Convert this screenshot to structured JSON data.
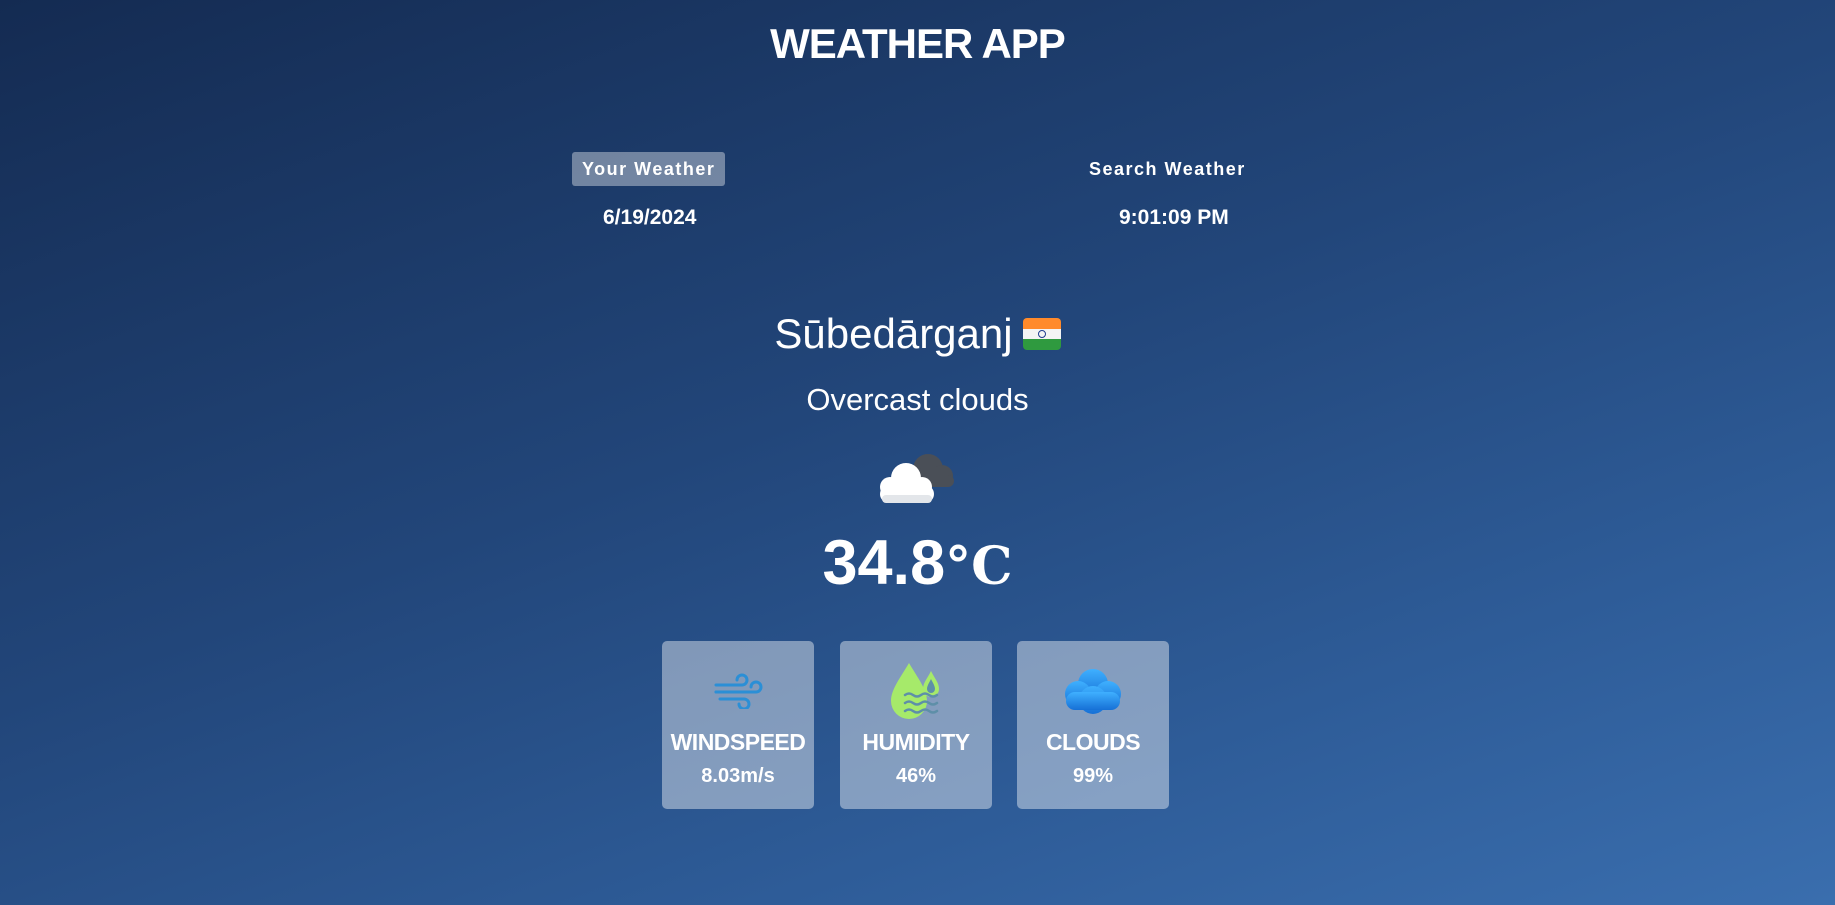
{
  "header": {
    "title": "WEATHER APP"
  },
  "tabs": {
    "your_weather": "Your Weather",
    "search_weather": "Search Weather"
  },
  "datetime": {
    "date": "6/19/2024",
    "time": "9:01:09 PM"
  },
  "location": {
    "city": "Sūbedārganj",
    "country_flag_icon": "flag-india-icon"
  },
  "current": {
    "description": "Overcast clouds",
    "condition_icon": "overcast-cloud-icon",
    "temperature": "34.8",
    "unit": "°C"
  },
  "stats": [
    {
      "label": "WINDSPEED",
      "value": "8.03m/s",
      "icon": "wind-icon"
    },
    {
      "label": "HUMIDITY",
      "value": "46%",
      "icon": "humidity-icon"
    },
    {
      "label": "CLOUDS",
      "value": "99%",
      "icon": "cloud-icon"
    }
  ],
  "colors": {
    "background_start": "#142b52",
    "background_end": "#3a6eae",
    "wind_icon": "#2b8fd6",
    "humidity_icon": "#a6ea6a",
    "cloud_icon": "#1f8ae8"
  }
}
